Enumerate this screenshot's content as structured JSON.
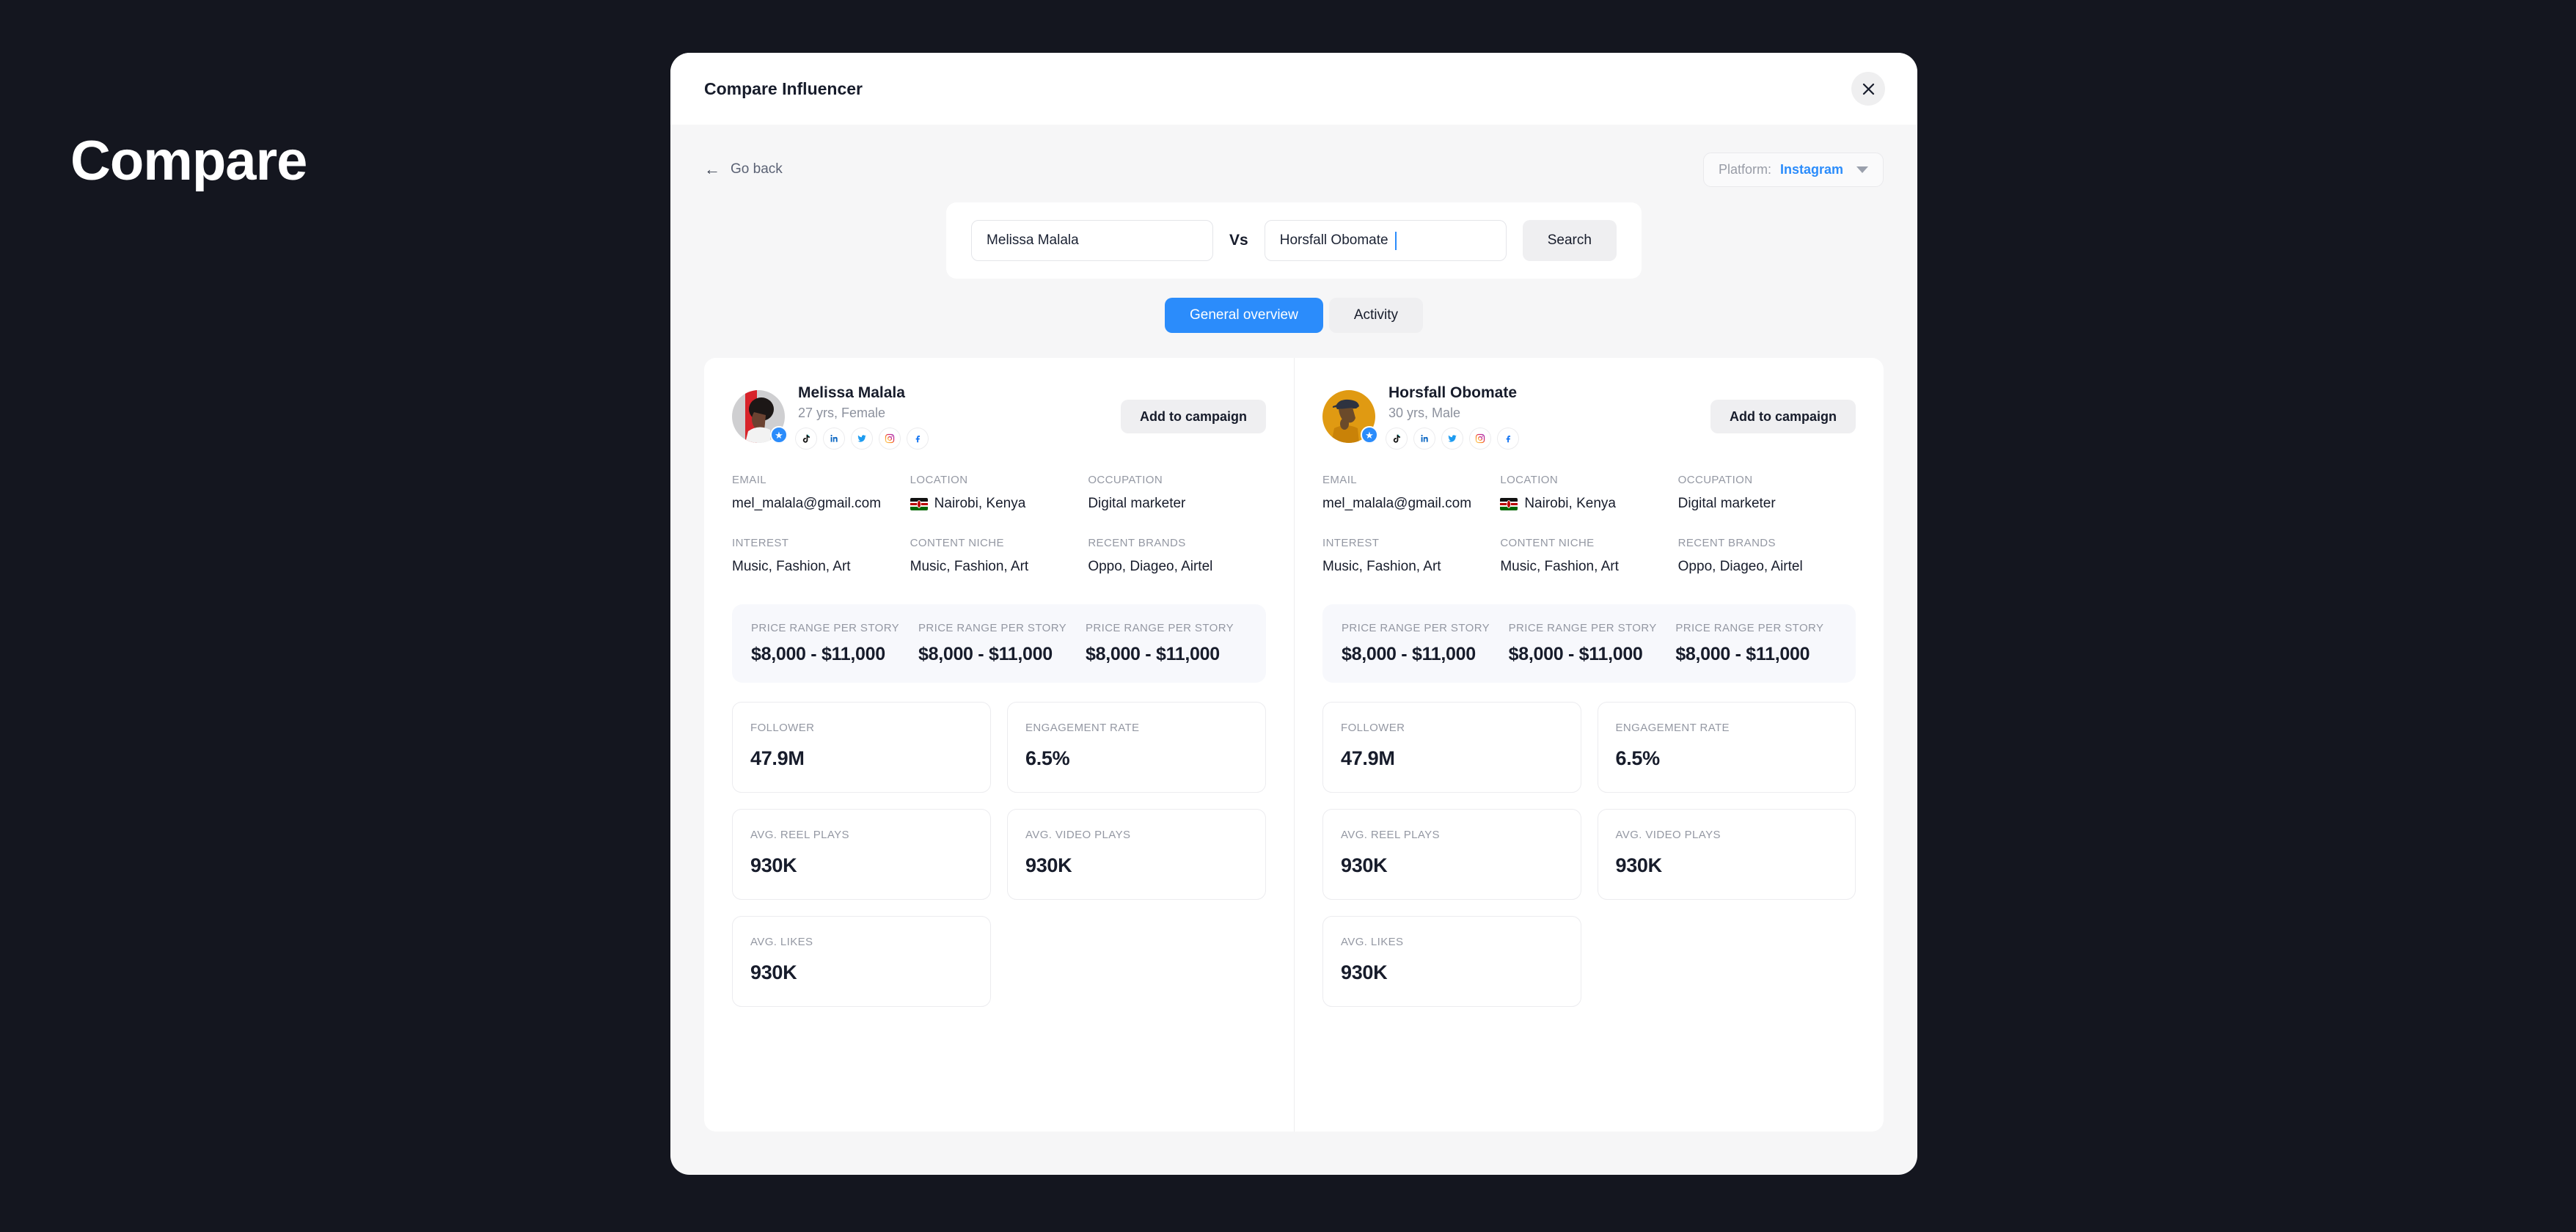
{
  "page": {
    "heading": "Compare",
    "background_color": "#14161F"
  },
  "modal": {
    "title": "Compare Influencer",
    "close_icon": "close-icon",
    "accent_color": "#2B8CFB",
    "body_color": "#F6F6F7"
  },
  "toolbar": {
    "go_back_label": "Go back",
    "back_arrow_icon": "arrow-left-icon",
    "platform_label": "Platform:",
    "platform_value": "Instagram",
    "platform_caret_icon": "chevron-down-icon"
  },
  "search": {
    "left_value": "Melissa Malala",
    "left_placeholder": "Influencer name",
    "vs_label": "Vs",
    "right_value": "Horsfall Obomate",
    "right_placeholder": "Influencer name",
    "right_has_caret": true,
    "search_button": "Search"
  },
  "tabs": [
    {
      "label": "General overview",
      "active": true
    },
    {
      "label": "Activity",
      "active": false
    }
  ],
  "field_labels": {
    "email": "EMAIL",
    "location": "LOCATION",
    "occupation": "OCCUPATION",
    "interest": "INTEREST",
    "content_niche": "CONTENT NICHE",
    "recent_brands": "RECENT BRANDS",
    "price_range": "PRICE RANGE PER STORY",
    "follower": "FOLLOWER",
    "engagement_rate": "ENGAGEMENT RATE",
    "avg_reel_plays": "AVG. REEL PLAYS",
    "avg_video_plays": "AVG. VIDEO PLAYS",
    "avg_likes": "AVG. LIKES"
  },
  "add_to_campaign_label": "Add to campaign",
  "social_icons": [
    "tiktok-icon",
    "linkedin-icon",
    "twitter-icon",
    "instagram-icon",
    "facebook-icon"
  ],
  "influencers": [
    {
      "name": "Melissa Malala",
      "sub": "27 yrs, Female",
      "avatar_colors": [
        "#C8C8CA",
        "#D8232A"
      ],
      "verified": true,
      "email": "mel_malala@gmail.com",
      "location": "Nairobi, Kenya",
      "location_flag": "kenya-flag",
      "occupation": "Digital marketer",
      "interest": "Music, Fashion, Art",
      "content_niche": "Music, Fashion, Art",
      "recent_brands": "Oppo, Diageo, Airtel",
      "price_ranges": [
        "$8,000 - $11,000",
        "$8,000 - $11,000",
        "$8,000 - $11,000"
      ],
      "follower": "47.9M",
      "engagement_rate": "6.5%",
      "avg_reel_plays": "930K",
      "avg_video_plays": "930K",
      "avg_likes": "930K"
    },
    {
      "name": "Horsfall Obomate",
      "sub": "30 yrs, Male",
      "avatar_colors": [
        "#E09A12",
        "#C98208"
      ],
      "verified": true,
      "email": "mel_malala@gmail.com",
      "location": "Nairobi, Kenya",
      "location_flag": "kenya-flag",
      "occupation": "Digital marketer",
      "interest": "Music, Fashion, Art",
      "content_niche": "Music, Fashion, Art",
      "recent_brands": "Oppo, Diageo, Airtel",
      "price_ranges": [
        "$8,000 - $11,000",
        "$8,000 - $11,000",
        "$8,000 - $11,000"
      ],
      "follower": "47.9M",
      "engagement_rate": "6.5%",
      "avg_reel_plays": "930K",
      "avg_video_plays": "930K",
      "avg_likes": "930K"
    }
  ]
}
